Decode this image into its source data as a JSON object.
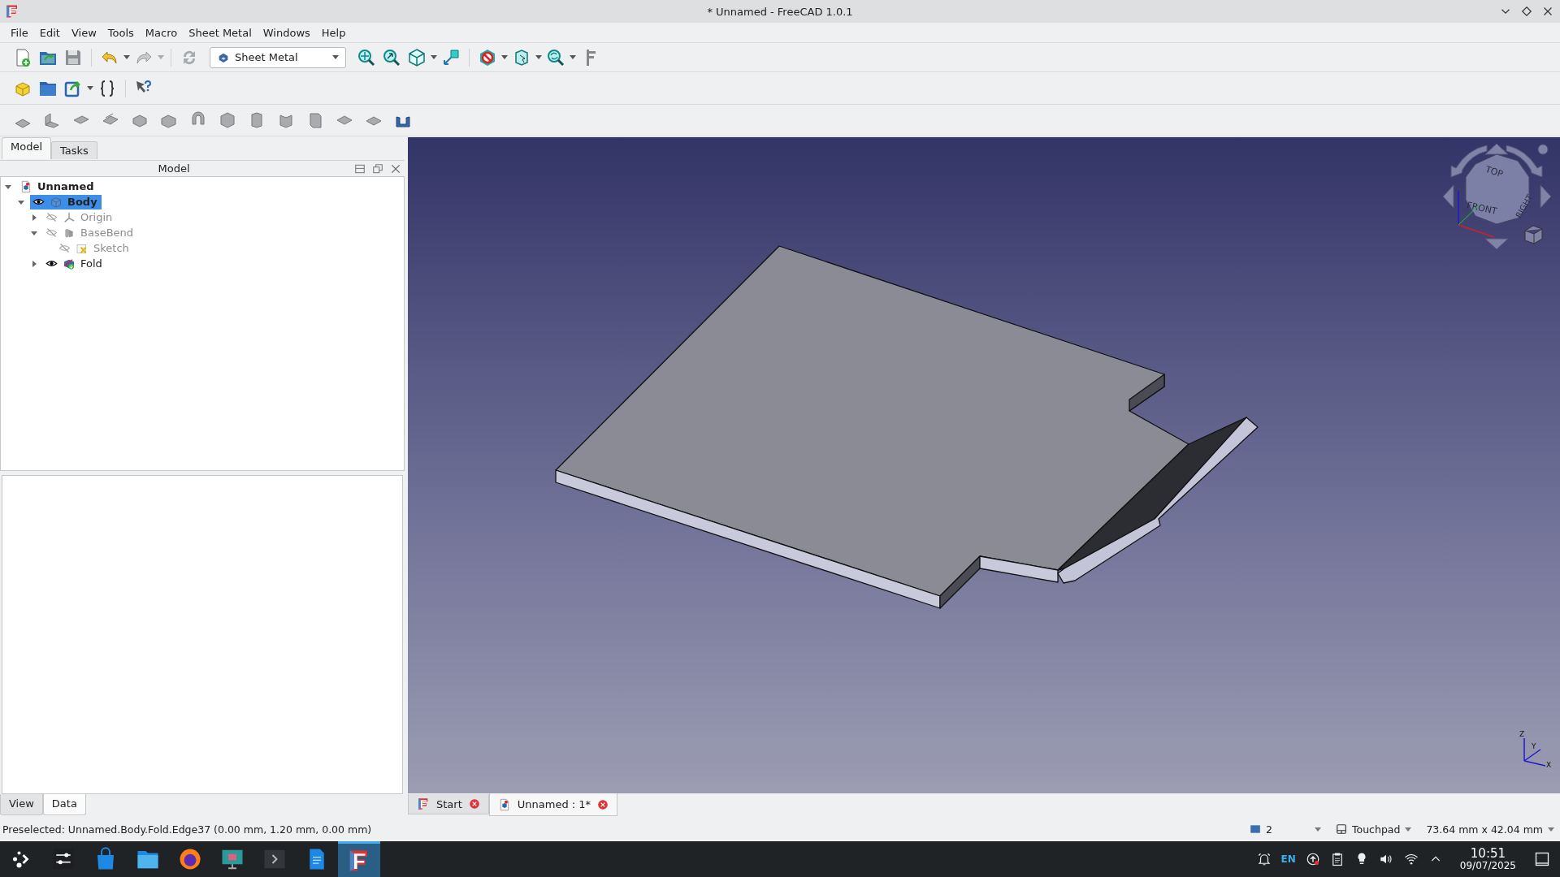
{
  "window": {
    "title": "* Unnamed - FreeCAD 1.0.1"
  },
  "menu": [
    "File",
    "Edit",
    "View",
    "Tools",
    "Macro",
    "Sheet Metal",
    "Windows",
    "Help"
  ],
  "toolbar": {
    "workbench": "Sheet Metal"
  },
  "panel_tabs": [
    {
      "label": "Model",
      "selected": true
    },
    {
      "label": "Tasks",
      "selected": false
    }
  ],
  "model_panel": {
    "title": "Model",
    "tree": [
      {
        "label": "Unnamed",
        "kind": "document",
        "selected": false,
        "expanded": true,
        "children": [
          {
            "label": "Body",
            "kind": "body",
            "selected": true,
            "visible": true,
            "expanded": true,
            "children": [
              {
                "label": "Origin",
                "kind": "origin",
                "selected": false,
                "visible": false,
                "expanded": false
              },
              {
                "label": "BaseBend",
                "kind": "basebend",
                "selected": false,
                "visible": false,
                "expanded": true,
                "children": [
                  {
                    "label": "Sketch",
                    "kind": "sketch",
                    "selected": false,
                    "visible": false
                  }
                ]
              },
              {
                "label": "Fold",
                "kind": "fold",
                "selected": false,
                "visible": true,
                "expanded": false
              }
            ]
          }
        ]
      }
    ]
  },
  "property_tabs": [
    {
      "label": "View",
      "selected": false
    },
    {
      "label": "Data",
      "selected": true
    }
  ],
  "viewport": {
    "nav_cube": {
      "faces": [
        "TOP",
        "FRONT",
        "RIGHT"
      ]
    },
    "axes": [
      "Z",
      "Y",
      "X"
    ]
  },
  "doc_tabs": [
    {
      "label": "Start",
      "kind": "start",
      "selected": false
    },
    {
      "label": "Unnamed : 1*",
      "kind": "document",
      "selected": true
    }
  ],
  "status_bar": {
    "message": "Preselected: Unnamed.Body.Fold.Edge37 (0.00 mm, 1.20 mm, 0.00 mm)",
    "pages": "2",
    "input": "Touchpad",
    "dimensions": "73.64 mm x 42.04 mm"
  },
  "taskbar": {
    "apps": [
      {
        "kind": "launcher",
        "selected": false
      },
      {
        "kind": "settings",
        "selected": false
      },
      {
        "kind": "store",
        "selected": false
      },
      {
        "kind": "files",
        "selected": false
      },
      {
        "kind": "browser",
        "selected": false
      },
      {
        "kind": "screenshot",
        "selected": false
      },
      {
        "kind": "terminal",
        "selected": false
      },
      {
        "kind": "writer",
        "selected": false
      },
      {
        "kind": "freecad",
        "selected": true
      }
    ],
    "tray": {
      "language": "EN",
      "time": "10:51",
      "date": "09/07/2025"
    }
  }
}
